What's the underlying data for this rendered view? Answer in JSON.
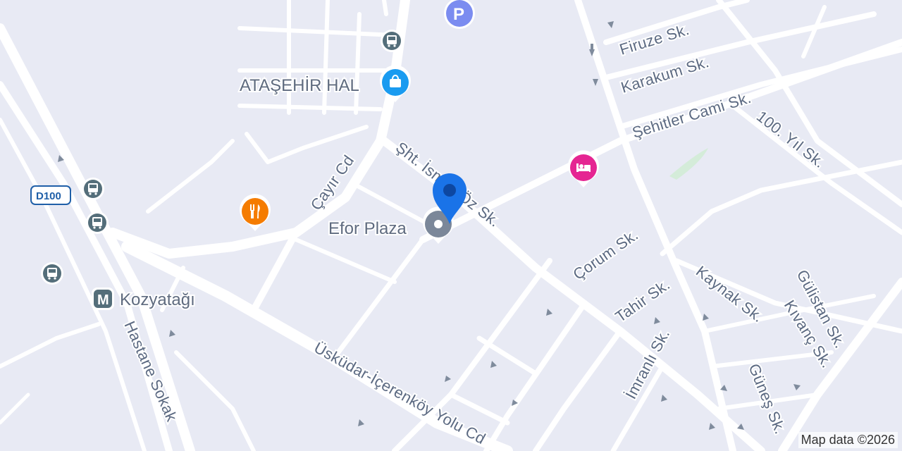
{
  "map": {
    "streets": {
      "cayir": "Çayır Cd",
      "sht": "Şht. İsmail Öz Sk.",
      "firuze": "Firuze Sk.",
      "karakum": "Karakum Sk.",
      "sehitler": "Şehitler Cami Sk.",
      "yil100": "100. Yıl Sk.",
      "corum": "Çorum Sk.",
      "tahir": "Tahir Sk.",
      "kaynak": "Kaynak Sk.",
      "gulistan": "Gülistan Sk.",
      "kivanc": "Kıvanç Sk.",
      "imranli": "İmranlı Sk.",
      "gunes": "Güneş Sk.",
      "hastane": "Hastane Sokak",
      "uskudar": "Üsküdar-İçerenköy Yolu Cd"
    },
    "places": {
      "atasehir_hal": "ATAŞEHİR HAL",
      "efor_plaza": "Efor Plaza",
      "kozyatagi": "Kozyatağı"
    },
    "shield": "D100",
    "metro_letter": "M",
    "parking_letter": "P",
    "attribution": "Map data ©2026",
    "colors": {
      "background": "#e8eaf4",
      "road": "#ffffff",
      "label": "#5c6a82",
      "marker_pin": "#1a73e8",
      "poi_gray": "#7b8799",
      "poi_shop": "#1a9bf0",
      "poi_food": "#f57c00",
      "poi_hotel": "#e52592",
      "poi_parking": "#7b8cf0",
      "poi_transit": "#546e7a"
    }
  }
}
